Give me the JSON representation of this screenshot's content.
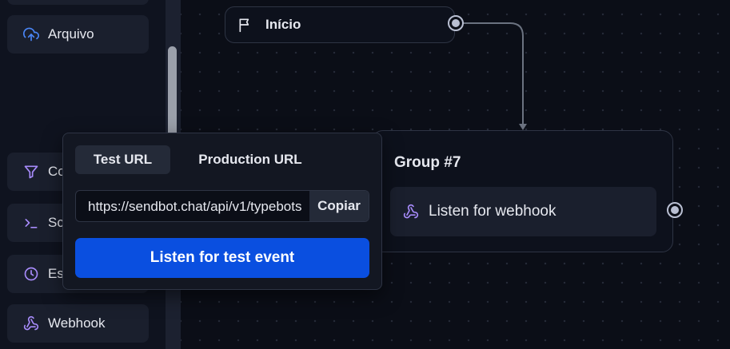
{
  "sidebar": {
    "items": [
      {
        "label": "Arquivo",
        "icon": "cloud-upload-icon"
      },
      {
        "label": "Co",
        "icon": "filter-icon"
      },
      {
        "label": "Sc",
        "icon": "terminal-icon"
      },
      {
        "label": "Es",
        "icon": "clock-icon"
      },
      {
        "label": "Webhook",
        "icon": "webhook-icon"
      }
    ]
  },
  "canvas": {
    "start_node": {
      "label": "Início",
      "icon": "flag-icon"
    },
    "group": {
      "title": "Group #7",
      "block": {
        "label": "Listen for webhook",
        "icon": "webhook-icon"
      }
    }
  },
  "popover": {
    "tabs": [
      {
        "label": "Test URL",
        "active": true
      },
      {
        "label": "Production URL",
        "active": false
      }
    ],
    "url": "https://sendbot.chat/api/v1/typebots",
    "copy_label": "Copiar",
    "listen_label": "Listen for test event"
  },
  "colors": {
    "background": "#0b0e17",
    "sidebar_item": "#1a1f2d",
    "primary_button": "#0a4fe0",
    "icon_blue": "#4a86f7",
    "icon_purple": "#a78bfa"
  }
}
